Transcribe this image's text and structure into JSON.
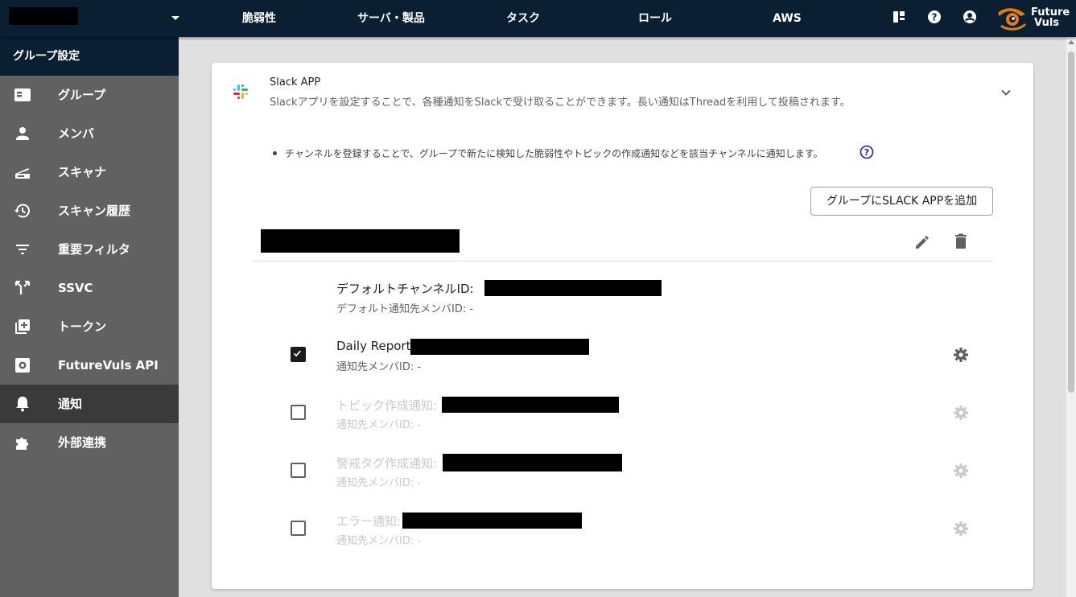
{
  "topbar": {
    "nav": [
      "脆弱性",
      "サーバ・製品",
      "タスク",
      "ロール",
      "AWS"
    ],
    "icons": [
      "dashboard-icon",
      "help-icon",
      "account-icon"
    ],
    "logo_text": [
      "Future",
      "Vuls"
    ]
  },
  "sidebar": {
    "header": "グループ設定",
    "items": [
      {
        "label": "グループ",
        "icon": "group-card-icon"
      },
      {
        "label": "メンバ",
        "icon": "person-icon"
      },
      {
        "label": "スキャナ",
        "icon": "scanner-icon"
      },
      {
        "label": "スキャン履歴",
        "icon": "history-icon"
      },
      {
        "label": "重要フィルタ",
        "icon": "filter-icon"
      },
      {
        "label": "SSVC",
        "icon": "split-icon"
      },
      {
        "label": "トークン",
        "icon": "add-box-icon"
      },
      {
        "label": "FutureVuls API",
        "icon": "api-gear-icon"
      },
      {
        "label": "通知",
        "icon": "bell-icon",
        "active": true
      },
      {
        "label": "外部連携",
        "icon": "puzzle-icon"
      }
    ]
  },
  "card": {
    "title": "Slack APP",
    "subtitle": "Slackアプリを設定することで、各種通知をSlackで受け取ることができます。長い通知はThreadを利用して投稿されます。",
    "info": "チャンネルを登録することで、グループで新たに検知した脆弱性やトピックの作成通知などを該当チャンネルに通知します。",
    "add_button": "グループにSLACK APPを追加",
    "default_channel": {
      "title": "デフォルトチャンネルID:",
      "sub": "デフォルト通知先メンバID: -"
    },
    "notifications": [
      {
        "title": "Daily Report:",
        "sub": "通知先メンバID: -",
        "checked": true
      },
      {
        "title": "トピック作成通知:",
        "sub": "通知先メンバID: -",
        "checked": false
      },
      {
        "title": "警戒タグ作成通知:",
        "sub": "通知先メンバID: -",
        "checked": false
      },
      {
        "title": "エラー通知:",
        "sub": "通知先メンバID: -",
        "checked": false
      }
    ]
  },
  "colors": {
    "topbar_bg": "#0b1f33",
    "sidebar_bg": "#616161",
    "sidebar_active_bg": "#3a3a3a",
    "help_accent": "#1a1acc",
    "logo_orange": "#e07b1a"
  }
}
